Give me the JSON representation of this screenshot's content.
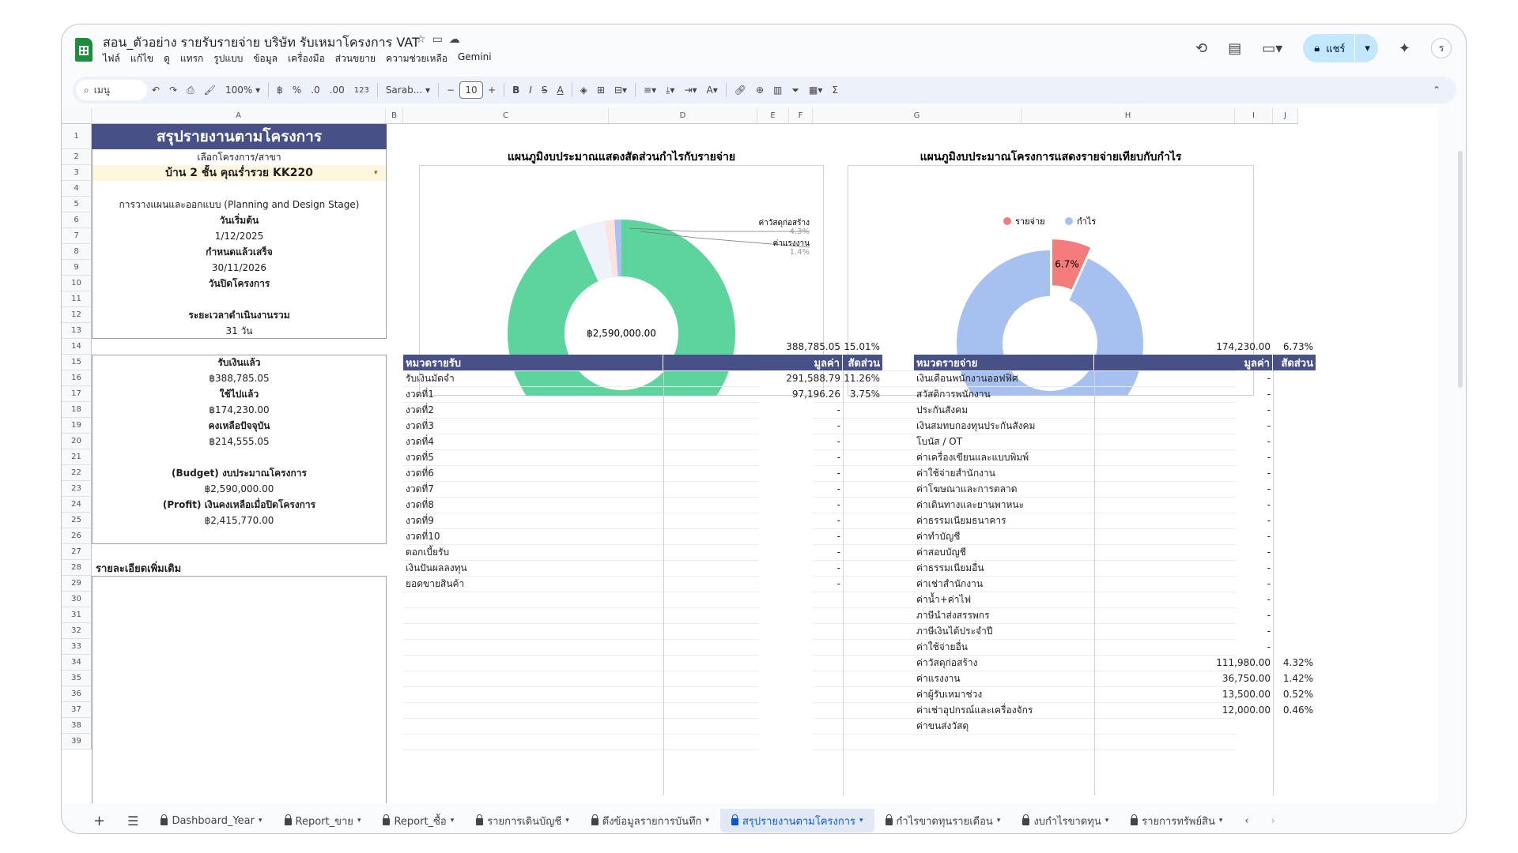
{
  "doc": {
    "title": "สอน_ตัวอย่าง รายรับรายจ่าย บริษัท รับเหมาโครงการ VAT",
    "menus": [
      "ไฟล์",
      "แก้ไข",
      "ดู",
      "แทรก",
      "รูปแบบ",
      "ข้อมูล",
      "เครื่องมือ",
      "ส่วนขยาย",
      "ความช่วยเหลือ",
      "Gemini"
    ],
    "share": "แชร์",
    "avatar": "ร"
  },
  "toolbar": {
    "search": "เมนู",
    "zoom": "100%",
    "currency": "฿",
    "percent": "%",
    "dec_minus": ".0",
    "dec_plus": ".00",
    "num": "123",
    "font": "Sarab...",
    "font_size": "10"
  },
  "columns": [
    "A",
    "B",
    "C",
    "D",
    "E",
    "F",
    "G",
    "H",
    "I",
    "J"
  ],
  "summary": {
    "title": "สรุปรายงานตามโครงการ",
    "select_label": "เลือกโครงการ/สาขา",
    "project": "บ้าน 2 ชั้น คุณร่ำรวย KK220",
    "stage": "การวางแผนและออกแบบ (Planning and Design Stage)",
    "start_label": "วันเริ่มต้น",
    "start": "1/12/2025",
    "end_label": "กำหนดแล้วเสร็จ",
    "end": "30/11/2026",
    "close_label": "วันปิดโครงการ",
    "close": "",
    "duration_label": "ระยะเวลาดำเนินงานรวม",
    "duration": "31 วัน",
    "received_label": "รับเงินแล้ว",
    "received": "฿388,785.05",
    "spent_label": "ใช้ไปแล้ว",
    "spent": "฿174,230.00",
    "balance_label": "คงเหลือปัจจุบัน",
    "balance": "฿214,555.05",
    "budget_label": "(Budget) งบประมาณโครงการ",
    "budget": "฿2,590,000.00",
    "profit_label": "(Profit) เงินคงเหลือเมื่อปิดโครงการ",
    "profit": "฿2,415,770.00",
    "more_label": "รายละเอียดเพิ่มเติม"
  },
  "income": {
    "total": "388,785.05",
    "total_pct": "15.01%",
    "headers": [
      "หมวดรายรับ",
      "มูลค่า",
      "สัดส่วน"
    ],
    "rows": [
      [
        "รับเงินมัดจำ",
        "291,588.79",
        "11.26%"
      ],
      [
        "งวดที่1",
        "97,196.26",
        "3.75%"
      ],
      [
        "งวดที่2",
        "-",
        ""
      ],
      [
        "งวดที่3",
        "-",
        ""
      ],
      [
        "งวดที่4",
        "-",
        ""
      ],
      [
        "งวดที่5",
        "-",
        ""
      ],
      [
        "งวดที่6",
        "-",
        ""
      ],
      [
        "งวดที่7",
        "-",
        ""
      ],
      [
        "งวดที่8",
        "-",
        ""
      ],
      [
        "งวดที่9",
        "-",
        ""
      ],
      [
        "งวดที่10",
        "-",
        ""
      ],
      [
        "ดอกเบี้ยรับ",
        "-",
        ""
      ],
      [
        "เงินปันผลลงทุน",
        "-",
        ""
      ],
      [
        "ยอดขายสินค้า",
        "-",
        ""
      ]
    ]
  },
  "expense": {
    "total": "174,230.00",
    "total_pct": "6.73%",
    "headers": [
      "หมวดรายจ่าย",
      "มูลค่า",
      "สัดส่วน"
    ],
    "rows": [
      [
        "เงินเดือนพนักงานออฟฟิศ",
        "-",
        ""
      ],
      [
        "สวัสดิการพนักงาน",
        "-",
        ""
      ],
      [
        "ประกันสังคม",
        "-",
        ""
      ],
      [
        "เงินสมทบกองทุนประกันสังคม",
        "-",
        ""
      ],
      [
        "โบนัส / OT",
        "-",
        ""
      ],
      [
        "ค่าเครื่องเขียนและแบบพิมพ์",
        "-",
        ""
      ],
      [
        "ค่าใช้จ่ายสำนักงาน",
        "-",
        ""
      ],
      [
        "ค่าโฆษณาและการตลาด",
        "-",
        ""
      ],
      [
        "ค่าเดินทางและยานพาหนะ",
        "-",
        ""
      ],
      [
        "ค่าธรรมเนียมธนาคาร",
        "-",
        ""
      ],
      [
        "ค่าทำบัญชี",
        "-",
        ""
      ],
      [
        "ค่าสอบบัญชี",
        "-",
        ""
      ],
      [
        "ค่าธรรมเนียมอื่น",
        "-",
        ""
      ],
      [
        "ค่าเช่าสำนักงาน",
        "-",
        ""
      ],
      [
        "ค่าน้ำ+ค่าไฟ",
        "-",
        ""
      ],
      [
        "ภาษีนำส่งสรรพกร",
        "-",
        ""
      ],
      [
        "ภาษีเงินได้ประจำปี",
        "-",
        ""
      ],
      [
        "ค่าใช้จ่ายอื่น",
        "-",
        ""
      ],
      [
        "ค่าวัสดุก่อสร้าง",
        "111,980.00",
        "4.32%"
      ],
      [
        "ค่าแรงงาน",
        "36,750.00",
        "1.42%"
      ],
      [
        "ค่าผู้รับเหมาช่วง",
        "13,500.00",
        "0.52%"
      ],
      [
        "ค่าเช่าอุปกรณ์และเครื่องจักร",
        "12,000.00",
        "0.46%"
      ],
      [
        "ค่าขนส่งวัสดุ",
        "",
        ""
      ]
    ]
  },
  "chart_data": [
    {
      "type": "pie",
      "title": "แผนภูมิงบประมาณแสดงสัดส่วนกำไรกับรายจ่าย",
      "center_label": "฿2,590,000.00",
      "slices": [
        {
          "name": "กำไร",
          "value": 93.3,
          "label": "93.3%",
          "color": "#5dd39e"
        },
        {
          "name": "ค่าวัสดุก่อสร้าง",
          "value": 4.3,
          "label": "4.3%",
          "color": "#eef3fb"
        },
        {
          "name": "ค่าแรงงาน",
          "value": 1.4,
          "label": "1.4%",
          "color": "#fbe3df"
        },
        {
          "name": "other",
          "value": 1.0,
          "label": "",
          "color": "#a8c1ef"
        }
      ]
    },
    {
      "type": "pie",
      "title": "แผนภูมิงบประมาณโครงการแสดงรายจ่ายเทียบกับกำไร",
      "legend": [
        "รายจ่าย",
        "กำไร"
      ],
      "slices": [
        {
          "name": "รายจ่าย",
          "value": 6.7,
          "label": "6.7%",
          "color": "#f47c7c"
        },
        {
          "name": "กำไร",
          "value": 93.3,
          "label": "93.3%",
          "color": "#a6c1f0"
        }
      ]
    }
  ],
  "sheet_tabs": [
    "Dashboard_Year",
    "Report_ขาย",
    "Report_ซื้อ",
    "รายการเดินบัญชี",
    "ดึงข้อมูลรายการบันทึก",
    "สรุปรายงานตามโครงการ",
    "กำไรขาดทุนรายเดือน",
    "งบกำไรขาดทุน",
    "รายการทรัพย์สิน"
  ],
  "active_tab": "สรุปรายงานตามโครงการ"
}
